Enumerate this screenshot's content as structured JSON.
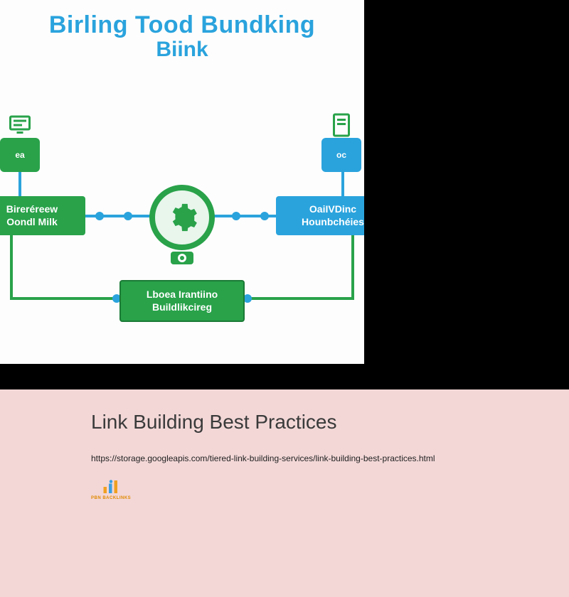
{
  "diagram": {
    "title_line1": "Birling Tood Bundking",
    "title_line2": "Biink",
    "node_left_small": "ea",
    "node_right_small": "oc",
    "box_left_line1": "Bireréreew",
    "box_left_line2": "Oondl Milk",
    "box_right_line1": "OaiIVDinc",
    "box_right_line2": "Hounbchéies",
    "box_bottom_line1": "Lboea Irantiino",
    "box_bottom_line2": "Buildlikcireg"
  },
  "info": {
    "title": "Link Building Best Practices",
    "url": "https://storage.googleapis.com/tiered-link-building-services/link-building-best-practices.html",
    "logo_label": "PBN BACKLINKS"
  },
  "colors": {
    "blue": "#2aa3dd",
    "green": "#29a24a",
    "panel_pink": "#f3d7d7"
  }
}
